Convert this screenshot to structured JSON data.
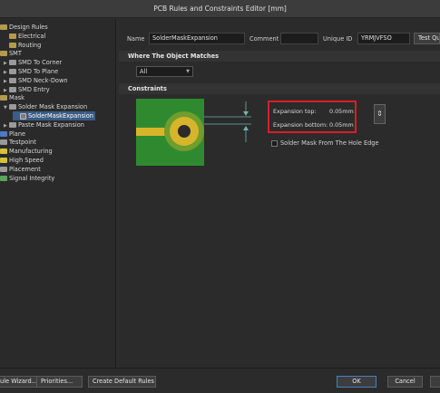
{
  "window": {
    "title": "PCB Rules and Constraints Editor [mm]"
  },
  "tree": {
    "items": [
      {
        "label": "Design Rules",
        "indent": 0,
        "icon": "folder",
        "twisty": ""
      },
      {
        "label": "Electrical",
        "indent": 1,
        "icon": "folder",
        "twisty": ""
      },
      {
        "label": "Routing",
        "indent": 1,
        "icon": "folder",
        "twisty": ""
      },
      {
        "label": "SMT",
        "indent": 0,
        "icon": "folder",
        "twisty": ""
      },
      {
        "label": "SMD To Corner",
        "indent": 1,
        "icon": "grey",
        "twisty": "▶"
      },
      {
        "label": "SMD To Plane",
        "indent": 1,
        "icon": "grey",
        "twisty": "▶"
      },
      {
        "label": "SMD Neck-Down",
        "indent": 1,
        "icon": "grey",
        "twisty": "▶"
      },
      {
        "label": "SMD Entry",
        "indent": 1,
        "icon": "grey",
        "twisty": "▶"
      },
      {
        "label": "Mask",
        "indent": 0,
        "icon": "folder",
        "twisty": ""
      },
      {
        "label": "Solder Mask Expansion",
        "indent": 1,
        "icon": "grey",
        "twisty": "▼"
      },
      {
        "label": "SolderMaskExpansion",
        "indent": 2,
        "icon": "doc",
        "twisty": "",
        "selected": true
      },
      {
        "label": "Paste Mask Expansion",
        "indent": 1,
        "icon": "grey",
        "twisty": "▶"
      },
      {
        "label": "Plane",
        "indent": 0,
        "icon": "blue",
        "twisty": ""
      },
      {
        "label": "Testpoint",
        "indent": 0,
        "icon": "grey",
        "twisty": ""
      },
      {
        "label": "Manufacturing",
        "indent": 0,
        "icon": "yellow",
        "twisty": ""
      },
      {
        "label": "High Speed",
        "indent": 0,
        "icon": "yellow",
        "twisty": ""
      },
      {
        "label": "Placement",
        "indent": 0,
        "icon": "grey",
        "twisty": ""
      },
      {
        "label": "Signal Integrity",
        "indent": 0,
        "icon": "green",
        "twisty": ""
      }
    ]
  },
  "rule": {
    "name_label": "Name",
    "name_value": "SolderMaskExpansion",
    "comment_label": "Comment",
    "comment_value": "",
    "unique_id_label": "Unique ID",
    "unique_id_value": "YRMJVFSO",
    "test_queries_label": "Test Queries"
  },
  "where": {
    "header": "Where The Object Matches",
    "scope_value": "All"
  },
  "constraints": {
    "header": "Constraints",
    "expansion_top_label": "Expansion top:",
    "expansion_top_value": "0.05mm",
    "expansion_bottom_label": "Expansion bottom:",
    "expansion_bottom_value": "0.05mm",
    "hole_edge_label": "Solder Mask From The Hole Edge",
    "hole_edge_checked": false
  },
  "footer": {
    "rule_wizard": "Rule Wizard...",
    "priorities": "Priorities...",
    "create_default": "Create Default Rules",
    "ok": "OK",
    "cancel": "Cancel"
  },
  "colors": {
    "pcb_green": "#2f8a2f",
    "pad_gold": "#d6b52a",
    "highlight_red": "#d81e2a"
  }
}
